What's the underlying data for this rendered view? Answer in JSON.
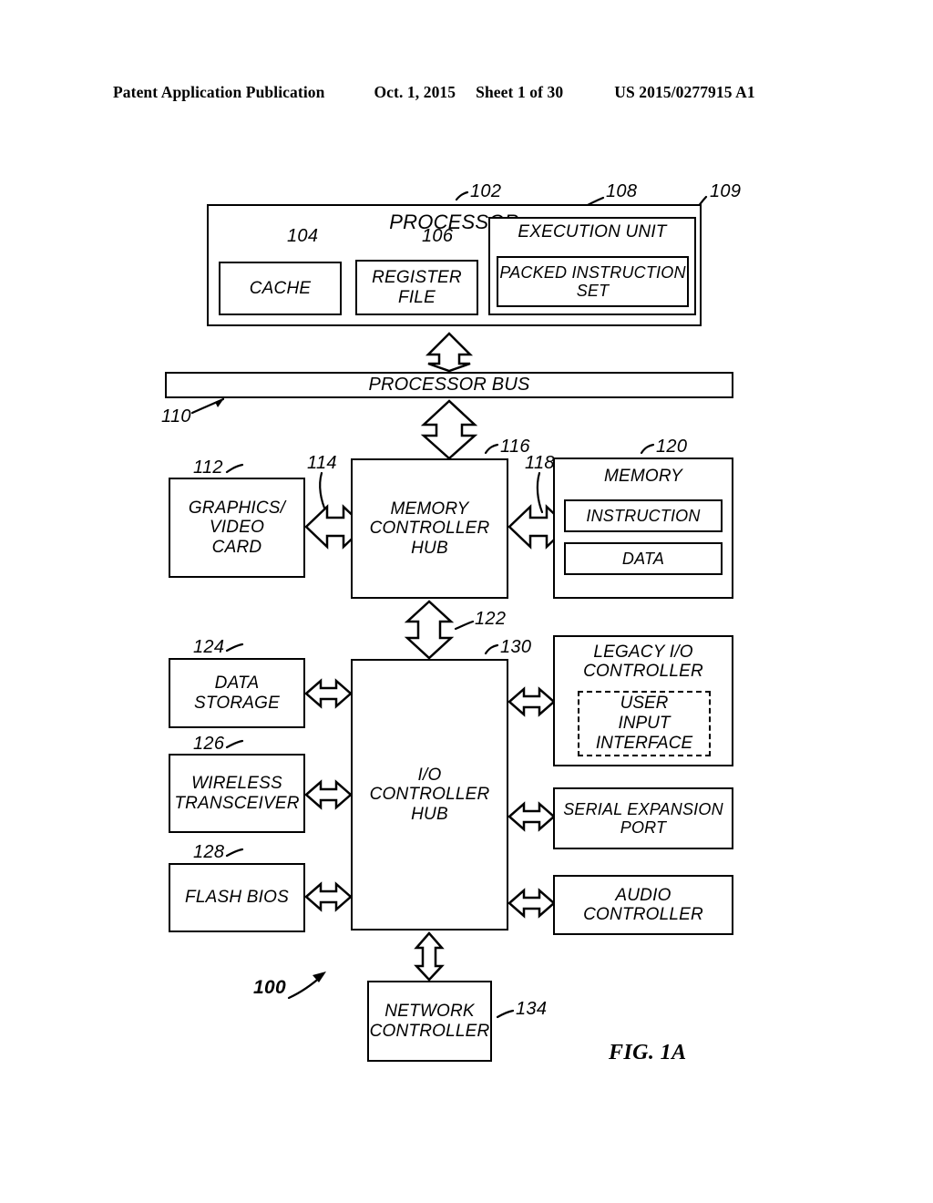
{
  "header": {
    "publication": "Patent Application Publication",
    "date": "Oct. 1, 2015",
    "sheet": "Sheet 1 of 30",
    "patent_number": "US 2015/0277915 A1"
  },
  "figure": {
    "caption": "FIG. 1A",
    "system_ref": "100"
  },
  "blocks": {
    "processor": {
      "label": "PROCESSOR",
      "ref": "102"
    },
    "cache": {
      "label": "CACHE",
      "ref": "104"
    },
    "register_file": {
      "label": "REGISTER\nFILE",
      "ref": "106"
    },
    "execution_unit": {
      "label": "EXECUTION UNIT",
      "ref": "108"
    },
    "packed_instruction_set": {
      "label": "PACKED INSTRUCTION\nSET",
      "ref": "109"
    },
    "processor_bus": {
      "label": "PROCESSOR BUS",
      "ref": "110"
    },
    "graphics_video_card": {
      "label": "GRAPHICS/\nVIDEO\nCARD",
      "ref": "112"
    },
    "graphics_link": {
      "ref": "114"
    },
    "memory_controller_hub": {
      "label": "MEMORY\nCONTROLLER\nHUB",
      "ref": "116"
    },
    "memory_link": {
      "ref": "118"
    },
    "memory": {
      "label": "MEMORY",
      "ref": "120"
    },
    "memory_instruction": {
      "label": "INSTRUCTION"
    },
    "memory_data": {
      "label": "DATA"
    },
    "hub_interface": {
      "ref": "122"
    },
    "data_storage": {
      "label": "DATA\nSTORAGE",
      "ref": "124"
    },
    "wireless_transceiver": {
      "label": "WIRELESS\nTRANSCEIVER",
      "ref": "126"
    },
    "flash_bios": {
      "label": "FLASH BIOS",
      "ref": "128"
    },
    "io_controller_hub": {
      "label": "I/O\nCONTROLLER\nHUB",
      "ref": "130"
    },
    "legacy_io_controller": {
      "label": "LEGACY I/O\nCONTROLLER"
    },
    "user_input_interface": {
      "label": "USER\nINPUT\nINTERFACE"
    },
    "serial_expansion_port": {
      "label": "SERIAL EXPANSION\nPORT"
    },
    "audio_controller": {
      "label": "AUDIO\nCONTROLLER"
    },
    "network_controller": {
      "label": "NETWORK\nCONTROLLER",
      "ref": "134"
    }
  },
  "style": {
    "line_color": "#000000",
    "background": "#ffffff"
  }
}
